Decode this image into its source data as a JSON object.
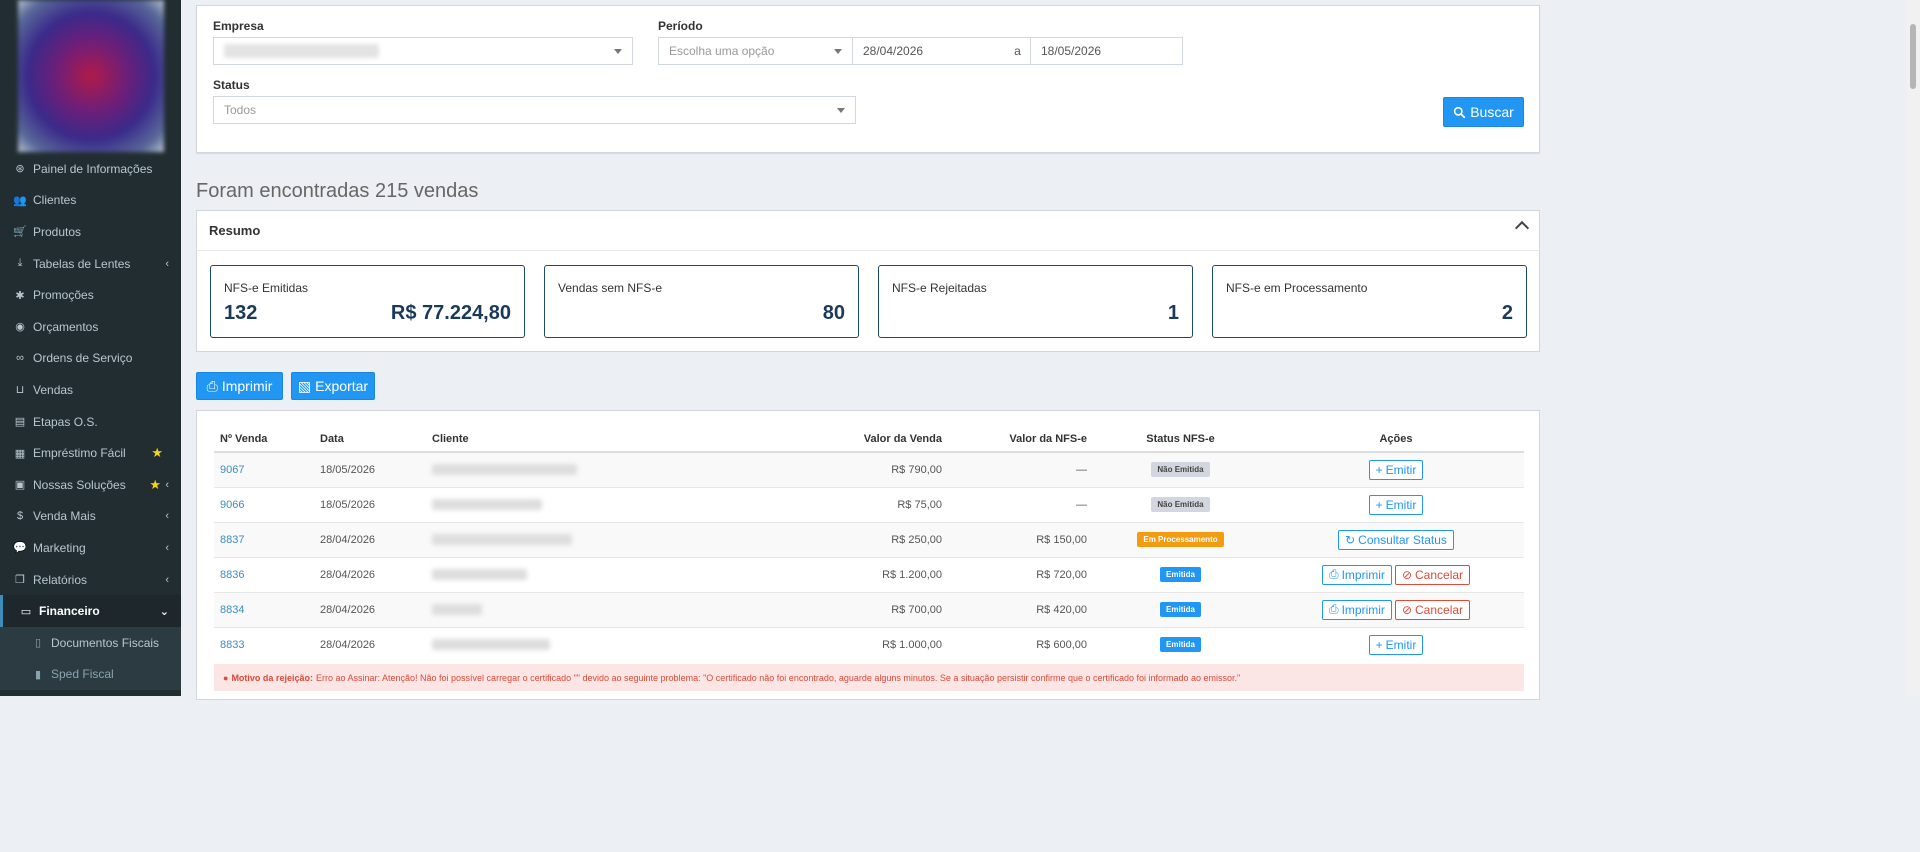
{
  "sidebar": {
    "items": [
      {
        "label": "Painel de Informações",
        "icon": "dashboard-icon",
        "glyph": "⊛"
      },
      {
        "label": "Clientes",
        "icon": "users-icon",
        "glyph": "👥"
      },
      {
        "label": "Produtos",
        "icon": "cart-icon",
        "glyph": "🛒"
      },
      {
        "label": "Tabelas de Lentes",
        "icon": "download-icon",
        "glyph": "⤓"
      },
      {
        "label": "Promoções",
        "icon": "asterisk-icon",
        "glyph": "✱"
      },
      {
        "label": "Orçamentos",
        "icon": "coins-icon",
        "glyph": "◉"
      },
      {
        "label": "Ordens de Serviço",
        "icon": "glasses-icon",
        "glyph": "∞"
      },
      {
        "label": "Vendas",
        "icon": "basket-icon",
        "glyph": "⊔"
      },
      {
        "label": "Etapas O.S.",
        "icon": "list-icon",
        "glyph": "▤"
      },
      {
        "label": "Empréstimo Fácil",
        "icon": "calculator-icon",
        "glyph": "▦"
      },
      {
        "label": "Nossas Soluções",
        "icon": "briefcase-icon",
        "glyph": "▣"
      },
      {
        "label": "Venda Mais",
        "icon": "dollar-icon",
        "glyph": "$"
      },
      {
        "label": "Marketing",
        "icon": "comments-icon",
        "glyph": "💬"
      },
      {
        "label": "Relatórios",
        "icon": "copy-icon",
        "glyph": "❐"
      },
      {
        "label": "Financeiro",
        "icon": "money-icon",
        "glyph": "▭"
      },
      {
        "label": "Documentos Fiscais",
        "icon": "file-icon",
        "glyph": "▯"
      },
      {
        "label": "Sped Fiscal",
        "icon": "file-icon",
        "glyph": "▮"
      }
    ]
  },
  "filters": {
    "empresa_label": "Empresa",
    "periodo_label": "Período",
    "periodo_select": "Escolha uma opção",
    "date_from": "28/04/2026",
    "date_sep": "a",
    "date_to": "18/05/2026",
    "status_label": "Status",
    "status_value": "Todos",
    "search_button": "Buscar"
  },
  "results_text": "Foram encontradas 215 vendas",
  "summary": {
    "title": "Resumo",
    "cards": [
      {
        "title": "NFS-e Emitidas",
        "count": "132",
        "value": "R$ 77.224,80"
      },
      {
        "title": "Vendas sem NFS-e",
        "count": "",
        "value": "80"
      },
      {
        "title": "NFS-e Rejeitadas",
        "count": "",
        "value": "1"
      },
      {
        "title": "NFS-e em Processamento",
        "count": "",
        "value": "2"
      }
    ]
  },
  "actions": {
    "print": "Imprimir",
    "export": "Exportar"
  },
  "table": {
    "headers": [
      "Nº Venda",
      "Data",
      "Cliente",
      "Valor da Venda",
      "Valor da NFS-e",
      "Status NFS-e",
      "Ações"
    ],
    "rows": [
      {
        "id": "9067",
        "date": "18/05/2026",
        "sale": "R$ 790,00",
        "nfse": "—",
        "status": "Não Emitida",
        "status_kind": "gray",
        "actions": [
          "Emitir"
        ]
      },
      {
        "id": "9066",
        "date": "18/05/2026",
        "sale": "R$ 75,00",
        "nfse": "—",
        "status": "Não Emitida",
        "status_kind": "gray",
        "actions": [
          "Emitir"
        ]
      },
      {
        "id": "8837",
        "date": "28/04/2026",
        "sale": "R$ 250,00",
        "nfse": "R$ 150,00",
        "status": "Em Processamento",
        "status_kind": "orange",
        "actions": [
          "Consultar Status"
        ]
      },
      {
        "id": "8836",
        "date": "28/04/2026",
        "sale": "R$ 1.200,00",
        "nfse": "R$ 720,00",
        "status": "Emitida",
        "status_kind": "blue",
        "actions": [
          "Imprimir",
          "Cancelar"
        ]
      },
      {
        "id": "8834",
        "date": "28/04/2026",
        "sale": "R$ 700,00",
        "nfse": "R$ 420,00",
        "status": "Emitida",
        "status_kind": "blue",
        "actions": [
          "Imprimir",
          "Cancelar"
        ]
      },
      {
        "id": "8833",
        "date": "28/04/2026",
        "sale": "R$ 1.000,00",
        "nfse": "R$ 600,00",
        "status": "Emitida",
        "status_kind": "blue",
        "actions": [
          "Emitir"
        ]
      }
    ],
    "rejection_label": "Motivo da rejeição:",
    "rejection_text": "Erro ao Assinar: Atenção! Não foi possível carregar o certificado \"\" devido ao seguinte problema: \"O certificado não foi encontrado, aguarde alguns minutos. Se a situação persistir confirme que o certificado foi informado ao emissor.\""
  }
}
